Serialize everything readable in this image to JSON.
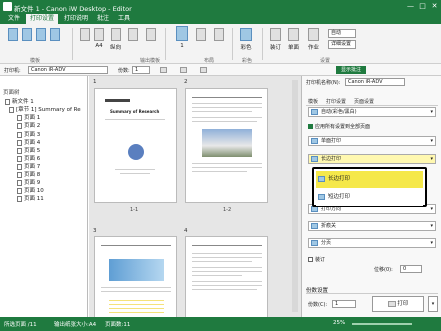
{
  "window": {
    "title": "新文件 1 - Canon iW Desktop - Editor",
    "minimize": "—",
    "maximize": "□",
    "close": "✕"
  },
  "menu": {
    "tabs": [
      {
        "label": "文件"
      },
      {
        "label": "打印设置"
      },
      {
        "label": "打印说明"
      },
      {
        "label": "批注"
      },
      {
        "label": "工具"
      }
    ]
  },
  "ribbon": {
    "buttons": [
      {
        "label": "A4"
      },
      {
        "label": "纵向"
      },
      {
        "label": "1"
      },
      {
        "label": "彩色"
      },
      {
        "label": "装订"
      },
      {
        "label": "单面"
      },
      {
        "label": "作业"
      }
    ],
    "options": [
      "自动",
      "详细设置"
    ],
    "groups": [
      "模板",
      "输出模板",
      "布局",
      "彩色",
      "设置"
    ]
  },
  "toolbar": {
    "printer_label": "打印机:",
    "printer_value": "Canon iR-ADV",
    "copies_label": "份数:",
    "copies_value": "1",
    "view_mode": "显示批注"
  },
  "tree": {
    "header": "页面树",
    "root": "新文件 1",
    "chapter": "[章节 1] Summary of Re",
    "pages": [
      "页面 1",
      "页面 2",
      "页面 3",
      "页面 4",
      "页面 5",
      "页面 6",
      "页面 7",
      "页面 8",
      "页面 9",
      "页面 10",
      "页面 11"
    ]
  },
  "preview": {
    "pages": [
      {
        "num": "1",
        "label": "1-1",
        "heading": "Summary of Research"
      },
      {
        "num": "2",
        "label": "1-2",
        "heading": ""
      },
      {
        "num": "3",
        "label": "",
        "heading": ""
      },
      {
        "num": "4",
        "label": "",
        "heading": ""
      }
    ]
  },
  "settings": {
    "printer_label": "打印机名称(N):",
    "printer_value": "Canon iR-ADV",
    "tabs": [
      "模板",
      "打印设置",
      "页面设置"
    ],
    "dropdown1": "自动(彩色/黑白)",
    "checkbox_all": "应用所有设置到全部页面",
    "dropdown2": "单面打印",
    "dropdown3": "长边打印",
    "options": [
      "长边打印",
      "短边打印"
    ],
    "dropdown4": "打印方向",
    "dropdown5": "折痕关",
    "dropdown6": "分页",
    "checkbox_staple": "装订",
    "offset_label": "位移(0):",
    "offset_value": "0",
    "copies_section": "份数设置",
    "copies_label": "份数(C):",
    "copies_value": "1",
    "print_button": "打印"
  },
  "status": {
    "page": "所选页面 /11",
    "size": "输出纸张大小:A4",
    "page_count": "页面数:11",
    "zoom": "25%"
  }
}
